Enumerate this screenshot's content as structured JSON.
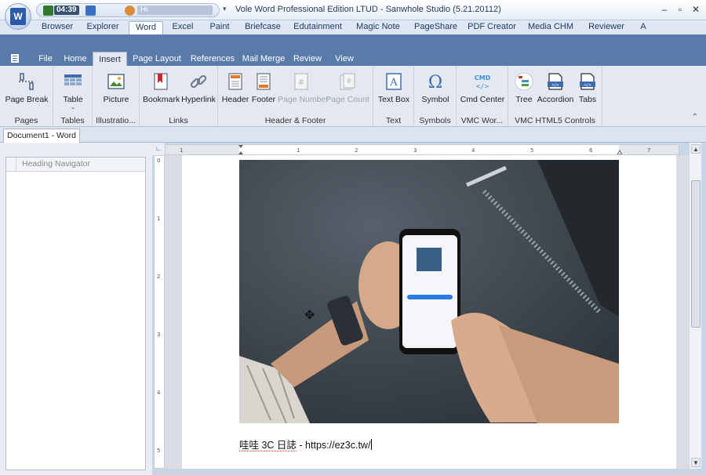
{
  "window": {
    "title": "Vole Word Professional Edition LTUD - Sanwhole Studio (5.21.20112)",
    "clock": "04:39",
    "user": "Hi"
  },
  "top_tabs": [
    {
      "label": "Browser"
    },
    {
      "label": "Explorer"
    },
    {
      "label": "Word",
      "active": true
    },
    {
      "label": "Excel"
    },
    {
      "label": "Paint"
    },
    {
      "label": "Briefcase"
    },
    {
      "label": "Edutainment"
    },
    {
      "label": "Magic Note"
    },
    {
      "label": "PageShare"
    },
    {
      "label": "PDF Creator"
    },
    {
      "label": "Media CHM"
    },
    {
      "label": "Reviewer"
    },
    {
      "label": "A"
    }
  ],
  "ribbon_tabs": [
    {
      "label": "File"
    },
    {
      "label": "Home"
    },
    {
      "label": "Insert",
      "active": true
    },
    {
      "label": "Page Layout"
    },
    {
      "label": "References"
    },
    {
      "label": "Mail Merge"
    },
    {
      "label": "Review"
    },
    {
      "label": "View"
    }
  ],
  "ribbon": {
    "groups": [
      {
        "label": "Pages",
        "buttons": [
          {
            "label": "Page Break",
            "icon": "page-break-icon"
          }
        ]
      },
      {
        "label": "Tables",
        "buttons": [
          {
            "label": "Table",
            "icon": "table-icon"
          }
        ]
      },
      {
        "label": "Illustratio...",
        "buttons": [
          {
            "label": "Picture",
            "icon": "picture-icon"
          }
        ]
      },
      {
        "label": "Links",
        "buttons": [
          {
            "label": "Bookmark",
            "icon": "bookmark-icon"
          },
          {
            "label": "Hyperlink",
            "icon": "hyperlink-icon"
          }
        ]
      },
      {
        "label": "Header & Footer",
        "buttons": [
          {
            "label": "Header",
            "icon": "header-icon"
          },
          {
            "label": "Footer",
            "icon": "footer-icon"
          },
          {
            "label": "Page Number",
            "icon": "page-number-icon",
            "disabled": true
          },
          {
            "label": "Page Count",
            "icon": "page-count-icon",
            "disabled": true
          }
        ]
      },
      {
        "label": "Text",
        "buttons": [
          {
            "label": "Text Box",
            "icon": "text-box-icon"
          }
        ]
      },
      {
        "label": "Symbols",
        "buttons": [
          {
            "label": "Symbol",
            "icon": "omega-icon"
          }
        ]
      },
      {
        "label": "VMC Wor...",
        "buttons": [
          {
            "label": "Cmd Center",
            "icon": "cmd-icon"
          }
        ]
      },
      {
        "label": "VMC HTML5 Controls",
        "buttons": [
          {
            "label": "Tree",
            "icon": "tree-icon"
          },
          {
            "label": "Accordion",
            "icon": "accordion-icon"
          },
          {
            "label": "Tabs",
            "icon": "tabs-icon"
          }
        ]
      }
    ]
  },
  "document_tab": "Document1 - Word",
  "navigator": {
    "header": "Heading Navigator"
  },
  "document": {
    "text_part1": "哇哇 3C 日誌",
    "text_part2": " - https://ez3c.tw/"
  },
  "colors": {
    "ribbon_band": "#5a7aaa",
    "ribbon_bg": "#e4e9f1",
    "accent": "#2b5aa8"
  }
}
